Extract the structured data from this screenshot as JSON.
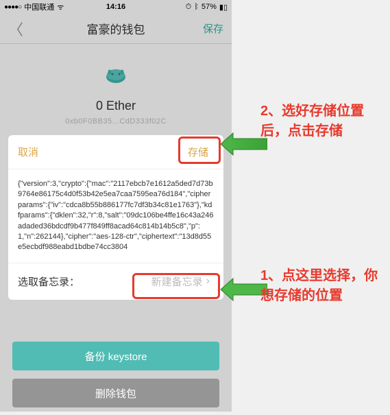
{
  "statusbar": {
    "signal": "●●●●○",
    "carrier": "中国联通",
    "wifi": "ᯤ",
    "time": "14:16",
    "alarm": "⏱",
    "bt": "ᛒ",
    "battery_pct": "57%",
    "battery_icon": "▮▯"
  },
  "navbar": {
    "back": "〈",
    "title": "富豪的钱包",
    "save": "保存"
  },
  "wallet": {
    "balance": "0 Ether",
    "address": "0xb0F0BB35...CdD333f02C"
  },
  "sheet": {
    "cancel": "取消",
    "store": "存储",
    "json_text": "{\"version\":3,\"crypto\":{\"mac\":\"2117ebcb7e1612a5ded7d73b9764e86175c4d0f53b42e5ea7caa7595ea76d184\",\"cipherparams\":{\"iv\":\"cdca8b55b886177fc7df3b34c81e1763\"},\"kdfparams\":{\"dklen\":32,\"r\":8,\"salt\":\"09dc106be4ffe16c43a246adaded36bdcdf9b477f849ff8acad64c814b14b5c8\",\"p\":1,\"n\":262144},\"cipher\":\"aes-128-ctr\",\"ciphertext\":\"13d8d55e5ecbdf988eabd1bdbe74cc3804",
    "memo_label": "选取备忘录：",
    "memo_select": "新建备忘录",
    "chevron": "›"
  },
  "buttons": {
    "backup": "备份 keystore",
    "delete": "删除钱包"
  },
  "annotations": {
    "a2": "2、选好存储位置后，点击存储",
    "a1": "1、点这里选择，你想存储的位置"
  }
}
